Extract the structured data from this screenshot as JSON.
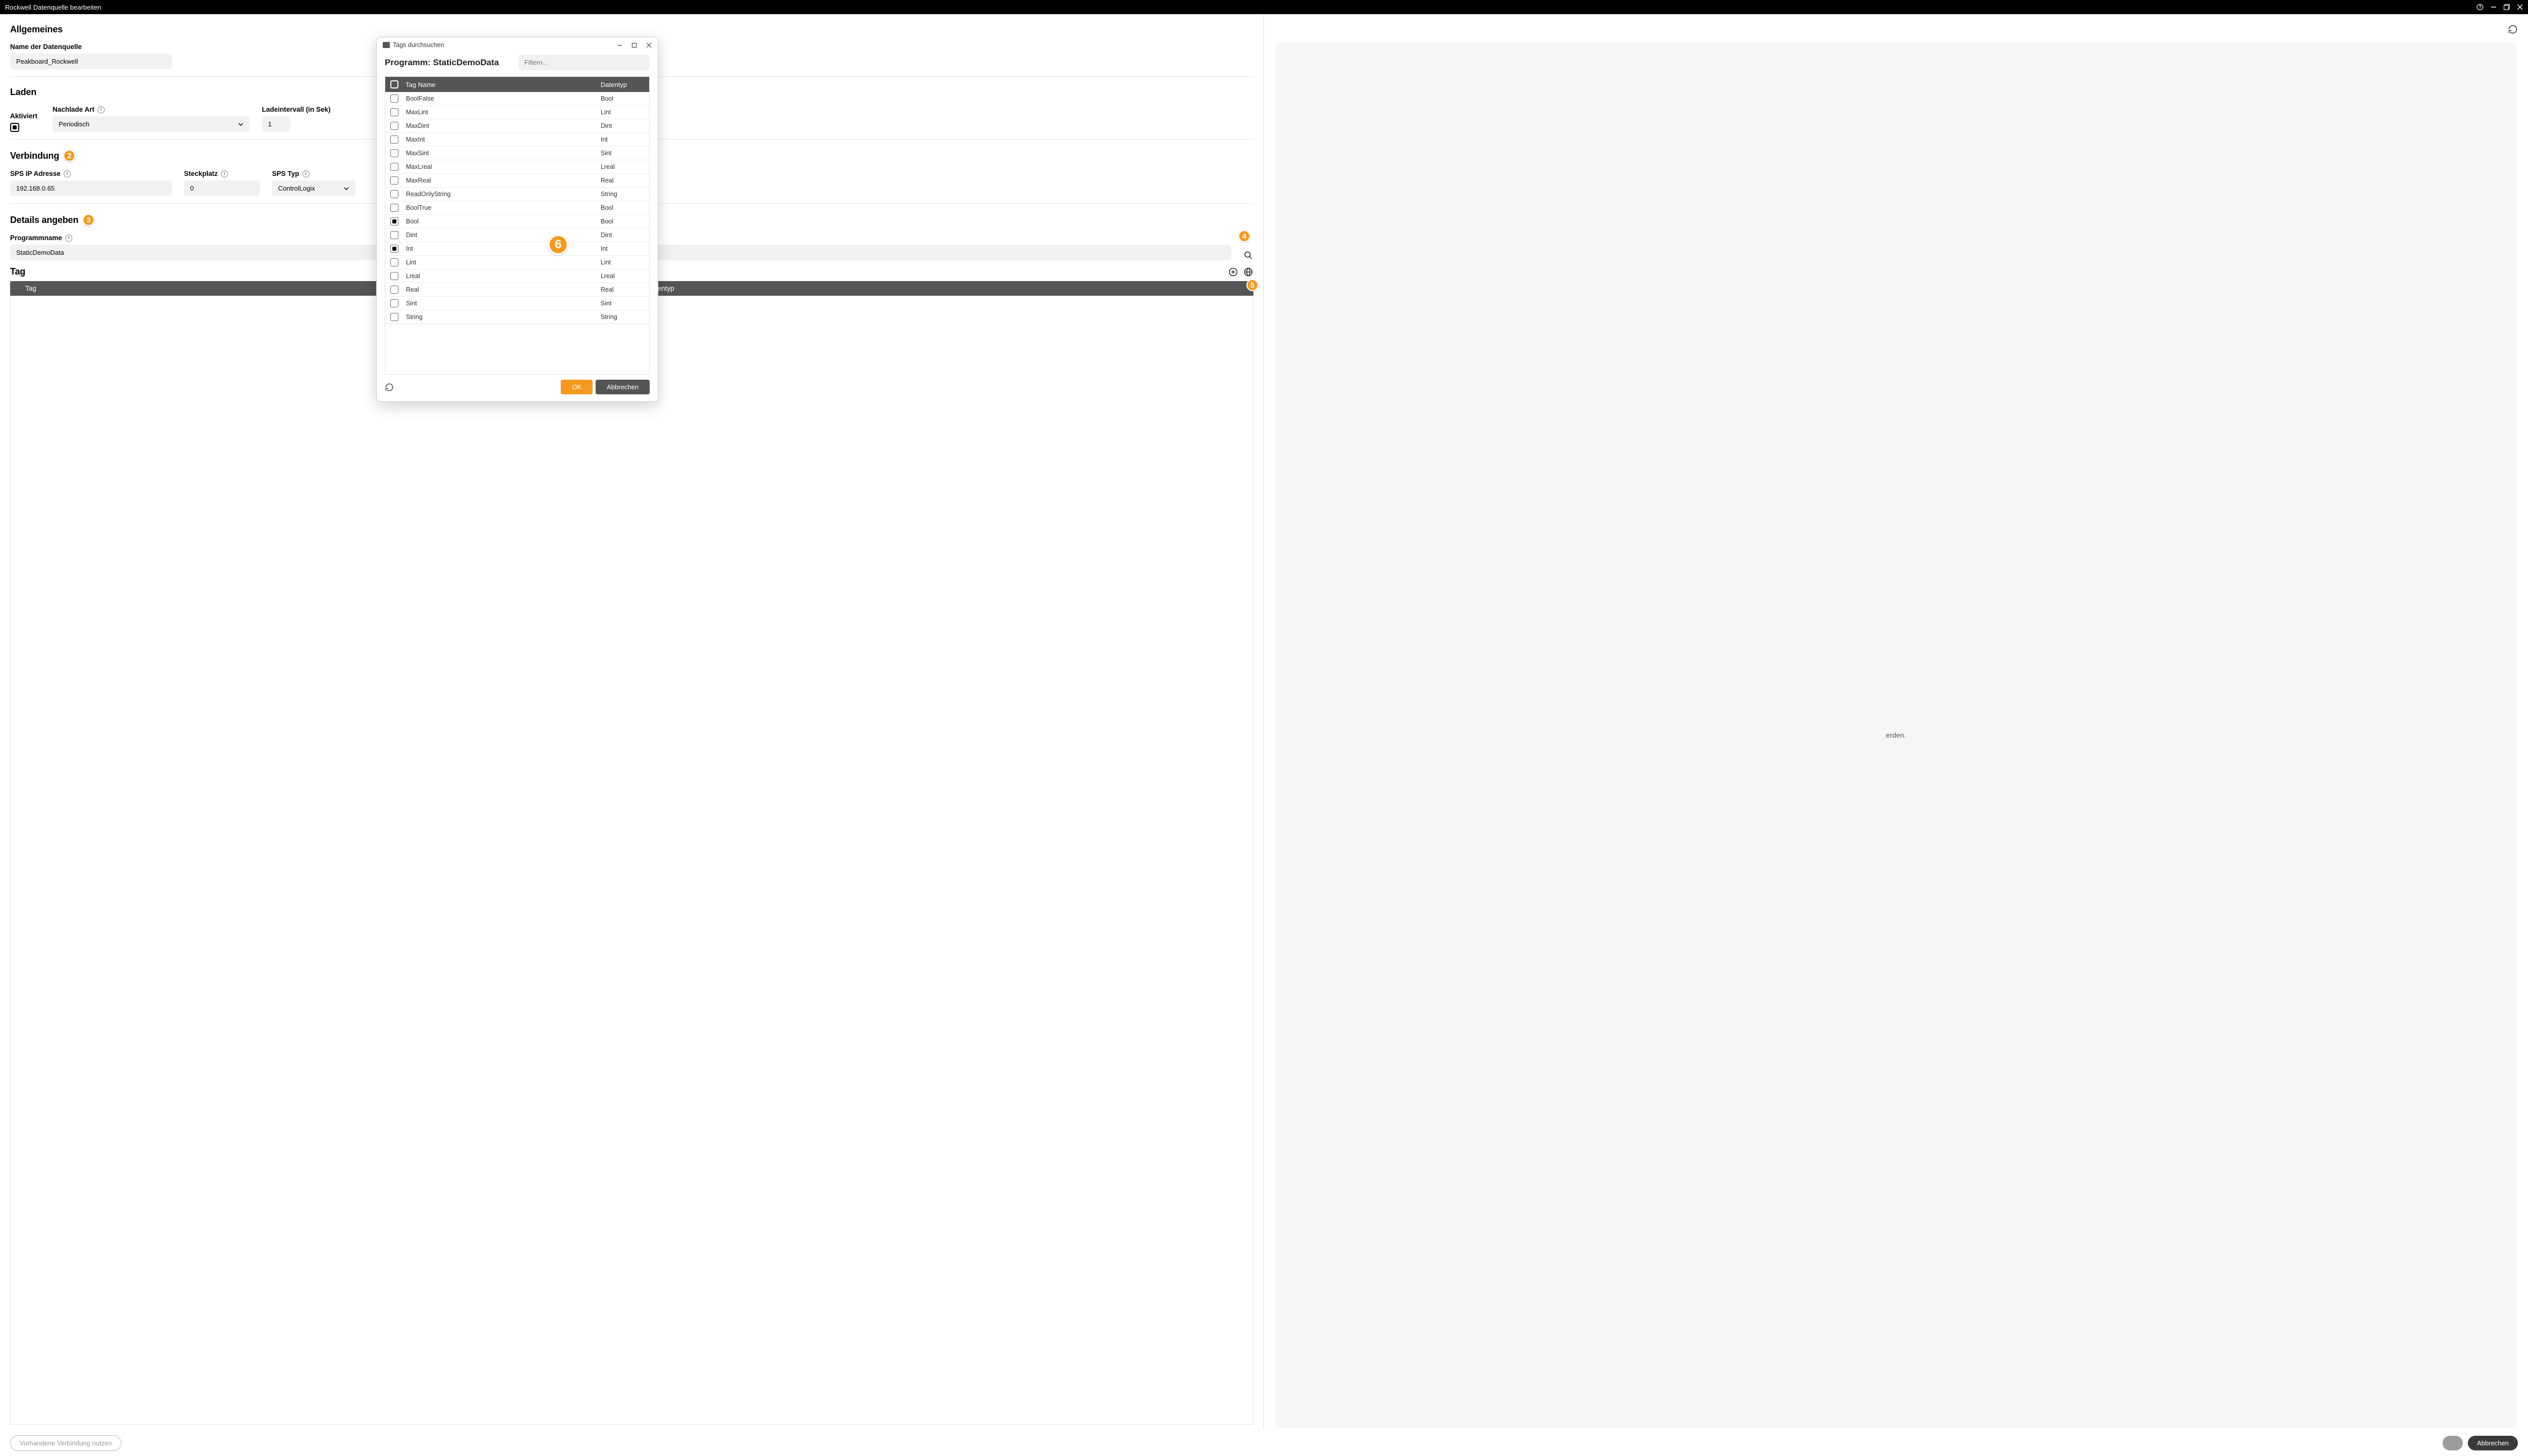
{
  "window": {
    "title": "Rockwell Datenquelle bearbeiten"
  },
  "sections": {
    "general": {
      "title": "Allgemeines",
      "name_label": "Name der Datenquelle",
      "name_value": "Peakboard_Rockwell"
    },
    "load": {
      "title": "Laden",
      "activated_label": "Aktiviert",
      "reload_label": "Nachlade Art",
      "reload_value": "Periodisch",
      "interval_label": "Ladeintervall (in Sek)",
      "interval_value": "1"
    },
    "connection": {
      "title": "Verbindung",
      "ip_label": "SPS IP Adresse",
      "ip_value": "192.168.0.65",
      "slot_label": "Steckplatz",
      "slot_value": "0",
      "type_label": "SPS Typ",
      "type_value": "ControlLogix"
    },
    "details": {
      "title": "Details angeben",
      "program_label": "Programmname",
      "program_value": "StaticDemoData"
    },
    "tag": {
      "title": "Tag",
      "col_tag": "Tag",
      "col_type": "Datentyp"
    }
  },
  "preview_message_suffix": "erden.",
  "footer": {
    "connection_btn": "Vorhandene Verbindung nutzen",
    "cancel": "Abbrechen"
  },
  "popup": {
    "title": "Tags durchsuchen",
    "header_prefix": "Programm: ",
    "header_program": "StaticDemoData",
    "filter_placeholder": "Filtern...",
    "col_name": "Tag Name",
    "col_type": "Datentyp",
    "rows": [
      {
        "name": "BoolFalse",
        "type": "Bool",
        "checked": false
      },
      {
        "name": "MaxLint",
        "type": "Lint",
        "checked": false
      },
      {
        "name": "MaxDint",
        "type": "Dint",
        "checked": false
      },
      {
        "name": "MaxInt",
        "type": "Int",
        "checked": false
      },
      {
        "name": "MaxSint",
        "type": "Sint",
        "checked": false
      },
      {
        "name": "MaxLreal",
        "type": "Lreal",
        "checked": false
      },
      {
        "name": "MaxReal",
        "type": "Real",
        "checked": false
      },
      {
        "name": "ReadOnlyString",
        "type": "String",
        "checked": false
      },
      {
        "name": "BoolTrue",
        "type": "Bool",
        "checked": false
      },
      {
        "name": "Bool",
        "type": "Bool",
        "checked": true
      },
      {
        "name": "Dint",
        "type": "Dint",
        "checked": false
      },
      {
        "name": "Int",
        "type": "Int",
        "checked": true
      },
      {
        "name": "Lint",
        "type": "Lint",
        "checked": false
      },
      {
        "name": "Lreal",
        "type": "Lreal",
        "checked": false
      },
      {
        "name": "Real",
        "type": "Real",
        "checked": false
      },
      {
        "name": "Sint",
        "type": "Sint",
        "checked": false
      },
      {
        "name": "String",
        "type": "String",
        "checked": false
      }
    ],
    "ok": "OK",
    "cancel": "Abbrechen"
  },
  "badges": {
    "b2": "2",
    "b3": "3",
    "b4": "4",
    "b5": "5",
    "b6": "6"
  }
}
